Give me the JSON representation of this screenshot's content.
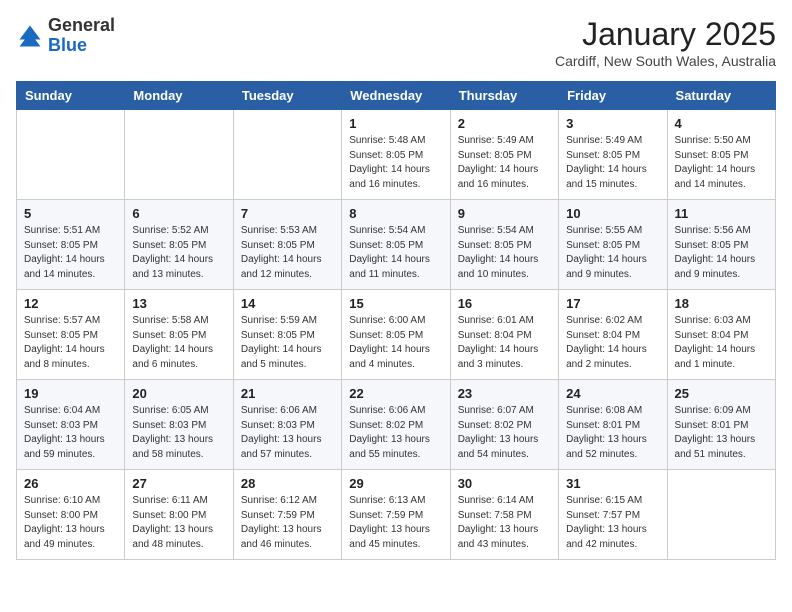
{
  "header": {
    "logo": {
      "general": "General",
      "blue": "Blue"
    },
    "title": "January 2025",
    "location": "Cardiff, New South Wales, Australia"
  },
  "weekdays": [
    "Sunday",
    "Monday",
    "Tuesday",
    "Wednesday",
    "Thursday",
    "Friday",
    "Saturday"
  ],
  "weeks": [
    [
      {
        "day": "",
        "info": ""
      },
      {
        "day": "",
        "info": ""
      },
      {
        "day": "",
        "info": ""
      },
      {
        "day": "1",
        "info": "Sunrise: 5:48 AM\nSunset: 8:05 PM\nDaylight: 14 hours\nand 16 minutes."
      },
      {
        "day": "2",
        "info": "Sunrise: 5:49 AM\nSunset: 8:05 PM\nDaylight: 14 hours\nand 16 minutes."
      },
      {
        "day": "3",
        "info": "Sunrise: 5:49 AM\nSunset: 8:05 PM\nDaylight: 14 hours\nand 15 minutes."
      },
      {
        "day": "4",
        "info": "Sunrise: 5:50 AM\nSunset: 8:05 PM\nDaylight: 14 hours\nand 14 minutes."
      }
    ],
    [
      {
        "day": "5",
        "info": "Sunrise: 5:51 AM\nSunset: 8:05 PM\nDaylight: 14 hours\nand 14 minutes."
      },
      {
        "day": "6",
        "info": "Sunrise: 5:52 AM\nSunset: 8:05 PM\nDaylight: 14 hours\nand 13 minutes."
      },
      {
        "day": "7",
        "info": "Sunrise: 5:53 AM\nSunset: 8:05 PM\nDaylight: 14 hours\nand 12 minutes."
      },
      {
        "day": "8",
        "info": "Sunrise: 5:54 AM\nSunset: 8:05 PM\nDaylight: 14 hours\nand 11 minutes."
      },
      {
        "day": "9",
        "info": "Sunrise: 5:54 AM\nSunset: 8:05 PM\nDaylight: 14 hours\nand 10 minutes."
      },
      {
        "day": "10",
        "info": "Sunrise: 5:55 AM\nSunset: 8:05 PM\nDaylight: 14 hours\nand 9 minutes."
      },
      {
        "day": "11",
        "info": "Sunrise: 5:56 AM\nSunset: 8:05 PM\nDaylight: 14 hours\nand 9 minutes."
      }
    ],
    [
      {
        "day": "12",
        "info": "Sunrise: 5:57 AM\nSunset: 8:05 PM\nDaylight: 14 hours\nand 8 minutes."
      },
      {
        "day": "13",
        "info": "Sunrise: 5:58 AM\nSunset: 8:05 PM\nDaylight: 14 hours\nand 6 minutes."
      },
      {
        "day": "14",
        "info": "Sunrise: 5:59 AM\nSunset: 8:05 PM\nDaylight: 14 hours\nand 5 minutes."
      },
      {
        "day": "15",
        "info": "Sunrise: 6:00 AM\nSunset: 8:05 PM\nDaylight: 14 hours\nand 4 minutes."
      },
      {
        "day": "16",
        "info": "Sunrise: 6:01 AM\nSunset: 8:04 PM\nDaylight: 14 hours\nand 3 minutes."
      },
      {
        "day": "17",
        "info": "Sunrise: 6:02 AM\nSunset: 8:04 PM\nDaylight: 14 hours\nand 2 minutes."
      },
      {
        "day": "18",
        "info": "Sunrise: 6:03 AM\nSunset: 8:04 PM\nDaylight: 14 hours\nand 1 minute."
      }
    ],
    [
      {
        "day": "19",
        "info": "Sunrise: 6:04 AM\nSunset: 8:03 PM\nDaylight: 13 hours\nand 59 minutes."
      },
      {
        "day": "20",
        "info": "Sunrise: 6:05 AM\nSunset: 8:03 PM\nDaylight: 13 hours\nand 58 minutes."
      },
      {
        "day": "21",
        "info": "Sunrise: 6:06 AM\nSunset: 8:03 PM\nDaylight: 13 hours\nand 57 minutes."
      },
      {
        "day": "22",
        "info": "Sunrise: 6:06 AM\nSunset: 8:02 PM\nDaylight: 13 hours\nand 55 minutes."
      },
      {
        "day": "23",
        "info": "Sunrise: 6:07 AM\nSunset: 8:02 PM\nDaylight: 13 hours\nand 54 minutes."
      },
      {
        "day": "24",
        "info": "Sunrise: 6:08 AM\nSunset: 8:01 PM\nDaylight: 13 hours\nand 52 minutes."
      },
      {
        "day": "25",
        "info": "Sunrise: 6:09 AM\nSunset: 8:01 PM\nDaylight: 13 hours\nand 51 minutes."
      }
    ],
    [
      {
        "day": "26",
        "info": "Sunrise: 6:10 AM\nSunset: 8:00 PM\nDaylight: 13 hours\nand 49 minutes."
      },
      {
        "day": "27",
        "info": "Sunrise: 6:11 AM\nSunset: 8:00 PM\nDaylight: 13 hours\nand 48 minutes."
      },
      {
        "day": "28",
        "info": "Sunrise: 6:12 AM\nSunset: 7:59 PM\nDaylight: 13 hours\nand 46 minutes."
      },
      {
        "day": "29",
        "info": "Sunrise: 6:13 AM\nSunset: 7:59 PM\nDaylight: 13 hours\nand 45 minutes."
      },
      {
        "day": "30",
        "info": "Sunrise: 6:14 AM\nSunset: 7:58 PM\nDaylight: 13 hours\nand 43 minutes."
      },
      {
        "day": "31",
        "info": "Sunrise: 6:15 AM\nSunset: 7:57 PM\nDaylight: 13 hours\nand 42 minutes."
      },
      {
        "day": "",
        "info": ""
      }
    ]
  ]
}
